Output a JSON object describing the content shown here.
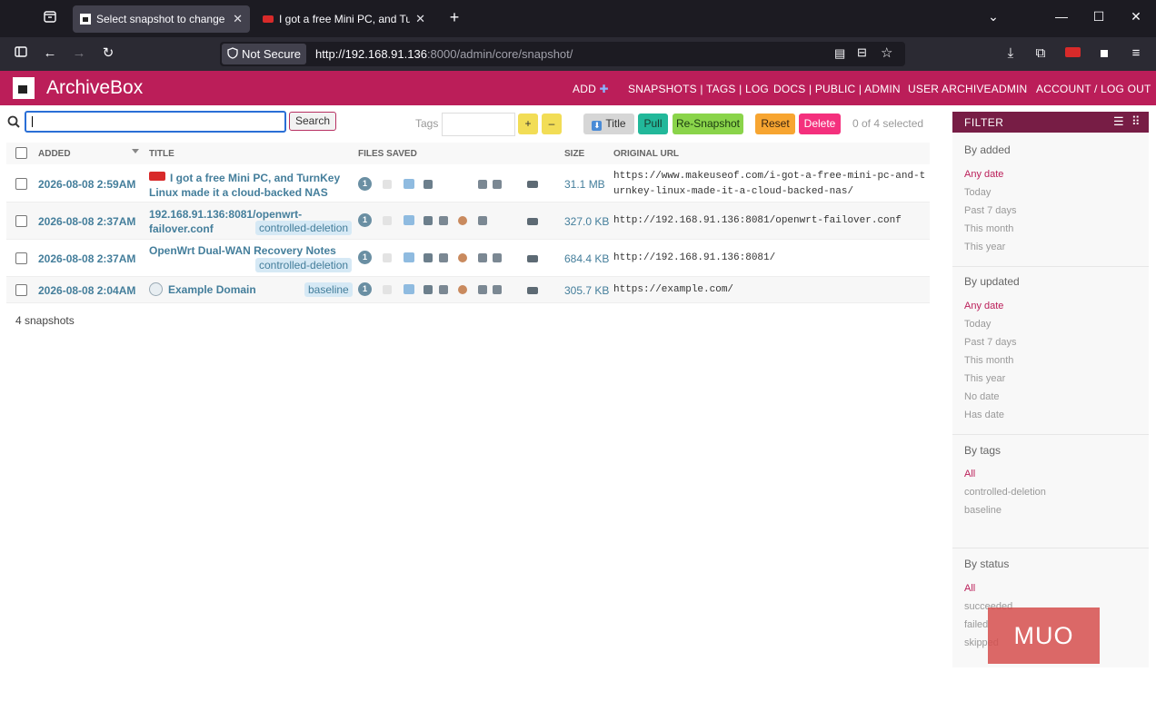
{
  "browser": {
    "tabs": [
      {
        "title": "Select snapshot to change | Ind",
        "active": true
      },
      {
        "title": "I got a free Mini PC, and TurnKe",
        "active": false
      }
    ],
    "security_label": "Not Secure",
    "url_host": "http://192.168.91.136",
    "url_rest": ":8000/admin/core/snapshot/"
  },
  "header": {
    "brand": "ArchiveBox",
    "add": "ADD",
    "nav1": "SNAPSHOTS | TAGS | LOG",
    "nav2": "DOCS | PUBLIC | ADMIN",
    "user": "USER ARCHIVEADMIN",
    "account": "ACCOUNT / LOG OUT"
  },
  "toolbar": {
    "search_value": "",
    "search_label": "Search",
    "tags_label": "Tags",
    "add_tag": "+",
    "remove_tag": "–",
    "title_btn": "Title",
    "pull_btn": "Pull",
    "resnapshot_btn": "Re-Snapshot",
    "reset_btn": "Reset",
    "delete_btn": "Delete",
    "selected": "0 of 4 selected"
  },
  "table": {
    "columns": [
      "ADDED",
      "TITLE",
      "FILES SAVED",
      "SIZE",
      "ORIGINAL URL"
    ],
    "rows": [
      {
        "added": "2026-08-08 2:59AM",
        "title1": "I got a free Mini PC, and TurnKey",
        "title2": "Linux made it a cloud-backed NAS",
        "tag": "",
        "files_count": "1",
        "size": "31.1 MB",
        "url1": "https://www.makeuseof.com/i-got-a-free-mini-pc-and-t",
        "url2": "urnkey-linux-made-it-a-cloud-backed-nas/"
      },
      {
        "added": "2026-08-08 2:37AM",
        "title1": "192.168.91.136:8081/openwrt-",
        "title2": "failover.conf",
        "tag": "controlled-deletion",
        "files_count": "1",
        "size": "327.0 KB",
        "url1": "http://192.168.91.136:8081/openwrt-failover.conf",
        "url2": ""
      },
      {
        "added": "2026-08-08 2:37AM",
        "title1": "OpenWrt Dual-WAN Recovery Notes",
        "title2": "",
        "tag": "controlled-deletion",
        "files_count": "1",
        "size": "684.4 KB",
        "url1": "http://192.168.91.136:8081/",
        "url2": ""
      },
      {
        "added": "2026-08-08 2:04AM",
        "title1": "Example Domain",
        "title2": "",
        "tag": "baseline",
        "files_count": "1",
        "size": "305.7 KB",
        "url1": "https://example.com/",
        "url2": ""
      }
    ],
    "count_label": "4 snapshots"
  },
  "filter": {
    "title": "FILTER",
    "groups": [
      {
        "title": "By added",
        "items": [
          "Any date",
          "Today",
          "Past 7 days",
          "This month",
          "This year"
        ]
      },
      {
        "title": "By updated",
        "items": [
          "Any date",
          "Today",
          "Past 7 days",
          "This month",
          "This year",
          "No date",
          "Has date"
        ]
      },
      {
        "title": "By tags",
        "items": [
          "All",
          "controlled-deletion",
          "baseline"
        ]
      },
      {
        "title": "By status",
        "items": [
          "All",
          "succeeded",
          "failed",
          "skipped"
        ]
      }
    ]
  },
  "watermark": "MUO",
  "colors": {
    "accent": "#bb1e59",
    "filter_head": "#771d45",
    "link": "#447e9b",
    "tag_bg": "#d6e9f5"
  }
}
